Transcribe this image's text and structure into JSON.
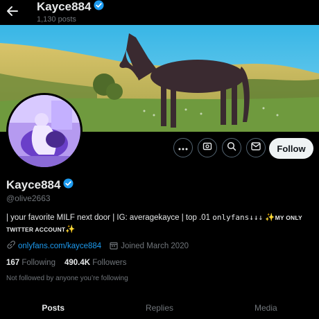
{
  "header": {
    "title": "Kayce884",
    "posts_count": "1,130 posts"
  },
  "profile": {
    "name": "Kayce884",
    "handle": "@olive2663",
    "bio_part1": "| your favorite MILF next door | IG: averagekayce | top .01 ",
    "bio_mono": "onlyfans↓↓↓",
    "bio_sparkle": "✨",
    "bio_caps": "MY ONLY TWITTER ACCOUNT",
    "bio_sparkle2": "✨",
    "link": "onlyfans.com/kayce884",
    "joined": "Joined March 2020",
    "following_count": "167",
    "following_label": "Following",
    "followers_count": "490.4K",
    "followers_label": "Followers",
    "not_followed_note": "Not followed by anyone you’re following"
  },
  "actions": {
    "follow_label": "Follow"
  },
  "tabs": [
    {
      "label": "Posts"
    },
    {
      "label": "Replies"
    },
    {
      "label": "Media"
    }
  ],
  "colors": {
    "accent": "#1d9bf0",
    "background": "#000000",
    "muted": "#71767b"
  }
}
